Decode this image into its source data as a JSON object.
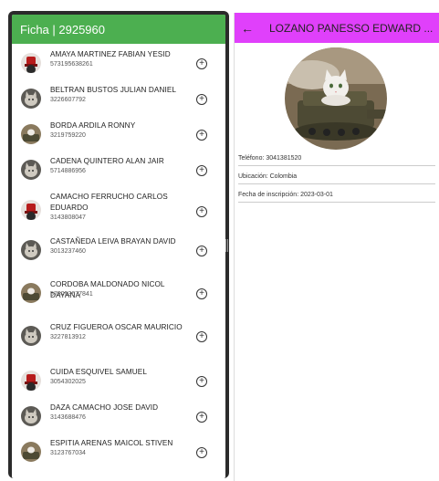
{
  "left_app": {
    "title": "Ficha | 2925960",
    "students": [
      {
        "name": "AMAYA MARTINEZ FABIAN YESID",
        "phone": "573195638261",
        "avatar": "hat-avatar"
      },
      {
        "name": "BELTRAN BUSTOS JULIAN DANIEL",
        "phone": "3226607792",
        "avatar": "cat-avatar"
      },
      {
        "name": "BORDA ARDILA RONNY",
        "phone": "3219759220",
        "avatar": "tank-cat-avatar"
      },
      {
        "name": "CADENA QUINTERO ALAN JAIR",
        "phone": "5714886956",
        "avatar": "cat-avatar"
      },
      {
        "name": "CAMACHO FERRUCHO CARLOS EDUARDO",
        "phone": "3143808047",
        "avatar": "hat-avatar"
      },
      {
        "name": "CASTAÑEDA LEIVA BRAYAN DAVID",
        "phone": "3013237460",
        "avatar": "cat-avatar"
      },
      {
        "name": "CORDOBA MALDONADO NICOL DAYANA",
        "phone": "573053677841",
        "avatar": "tank-cat-avatar"
      },
      {
        "name": "CRUZ FIGUEROA OSCAR MAURICIO",
        "phone": "3227813912",
        "avatar": "cat-avatar"
      },
      {
        "name": "CUIDA ESQUIVEL SAMUEL",
        "phone": "3054302025",
        "avatar": "hat-avatar"
      },
      {
        "name": "DAZA CAMACHO JOSE DAVID",
        "phone": "3143688476",
        "avatar": "cat-avatar"
      },
      {
        "name": "ESPITIA ARENAS MAICOL STIVEN",
        "phone": "3123767034",
        "avatar": "tank-cat-avatar"
      }
    ],
    "add_icon": "add-circle-icon",
    "colors": {
      "appbar": "#4caf50",
      "frame": "#2b2b2b"
    }
  },
  "right_app": {
    "back_icon": "←",
    "title": "LOZANO PANESSO EDWARD ...",
    "phone_line": "Teléfono: 3041381520",
    "location_line": "Ubicación: Colombia",
    "date_line": "Fecha de inscripción: 2023-03-01",
    "colors": {
      "appbar": "#e040fb"
    }
  }
}
